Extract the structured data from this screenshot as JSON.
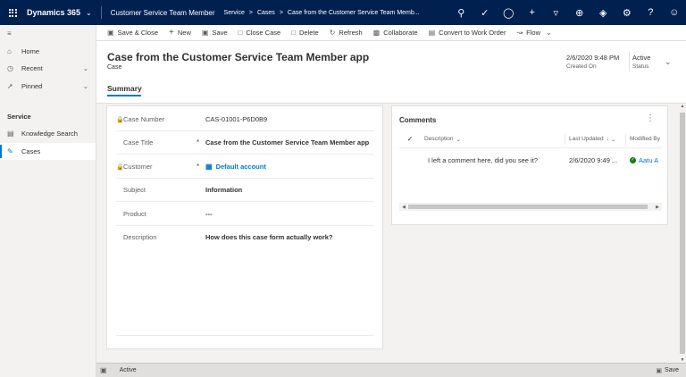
{
  "topbar": {
    "brand": "Dynamics 365",
    "app_name": "Customer Service Team Member",
    "breadcrumbs": [
      "Service",
      ">",
      "Cases",
      ">",
      "Case from the Customer Service Team Memb..."
    ],
    "icons": [
      "search-icon",
      "task-icon",
      "lightbulb-icon",
      "plus-icon",
      "filter-icon",
      "assistant-icon",
      "settings-alt-icon",
      "gear-icon",
      "help-icon",
      "user-icon"
    ]
  },
  "commands": [
    {
      "label": "Save & Close",
      "icon": "save-close-icon"
    },
    {
      "label": "New",
      "icon": "plus-icon"
    },
    {
      "label": "Save",
      "icon": "save-icon"
    },
    {
      "label": "Close Case",
      "icon": "close-case-icon"
    },
    {
      "label": "Delete",
      "icon": "delete-icon"
    },
    {
      "label": "Refresh",
      "icon": "refresh-icon"
    },
    {
      "label": "Collaborate",
      "icon": "collaborate-icon"
    },
    {
      "label": "Convert to Work Order",
      "icon": "convert-icon"
    },
    {
      "label": "Flow",
      "icon": "flow-icon"
    }
  ],
  "sidebar": {
    "items": [
      {
        "label": "Home",
        "icon": "home-icon"
      },
      {
        "label": "Recent",
        "icon": "clock-icon"
      },
      {
        "label": "Pinned",
        "icon": "pin-icon"
      }
    ],
    "section": "Service",
    "section_items": [
      {
        "label": "Knowledge Search",
        "icon": "book-icon"
      },
      {
        "label": "Cases",
        "icon": "wrench-icon"
      }
    ]
  },
  "header": {
    "title": "Case from the Customer Service Team Member app",
    "entity": "Case",
    "created_on_value": "2/6/2020 9:48 PM",
    "created_on_label": "Created On",
    "status_value": "Active",
    "status_label": "Status",
    "tab": "Summary"
  },
  "form": {
    "fields": [
      {
        "label": "Case Number",
        "value": "CAS-01001-P6D0B9",
        "locked": true,
        "required": false
      },
      {
        "label": "Case Title",
        "value": "Case from the Customer Service Team Member app",
        "required": true
      },
      {
        "label": "Customer",
        "value": "Default account",
        "locked": true,
        "required": true
      },
      {
        "label": "Subject",
        "value": "Information"
      },
      {
        "label": "Product",
        "value": "---"
      },
      {
        "label": "Description",
        "value": "How does this case form actually work?"
      }
    ]
  },
  "comments": {
    "title": "Comments",
    "columns": [
      "Description",
      "Last Updated",
      "Modified By"
    ],
    "rows": [
      {
        "description": "I left a comment here, did you see it?",
        "last_updated": "2/6/2020 9:49 ...",
        "modified_by": "Aatu A"
      }
    ]
  },
  "statusbar": {
    "status": "Active",
    "save_label": "Save"
  },
  "colors": {
    "topbar": "#002050",
    "accent": "#0078d4",
    "required": "#a4262c"
  }
}
